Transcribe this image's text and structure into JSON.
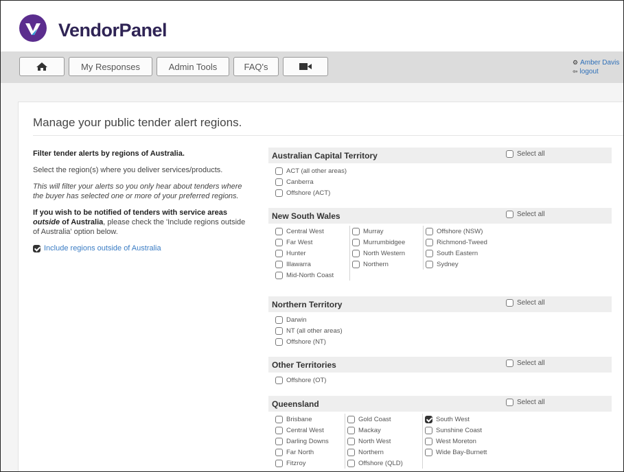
{
  "app": {
    "name": "VendorPanel"
  },
  "nav": {
    "buttons": [
      {
        "label": "",
        "icon": "home-icon"
      },
      {
        "label": "My Responses"
      },
      {
        "label": "Admin Tools"
      },
      {
        "label": "FAQ's"
      },
      {
        "label": "",
        "icon": "video-camera-icon"
      }
    ]
  },
  "user": {
    "name": "Amber Davis",
    "logout": "logout"
  },
  "page": {
    "heading": "Manage your public tender alert regions.",
    "filter_title": "Filter tender alerts by regions of Australia.",
    "select_text": "Select the region(s) where you deliver services/products.",
    "italic_text": "This will filter your alerts so you only hear about tenders where the buyer has selected one or more of your preferred regions.",
    "outside_bold_1": "If you wish to be notified of tenders with service areas ",
    "outside_bold_italic": "outside",
    "outside_bold_2": " of Australia",
    "outside_rest": ", please check the 'Include regions outside of Australia' option below.",
    "include_label": "Include regions outside of Australia",
    "include_checked": true
  },
  "select_all_label": "Select all",
  "regions": [
    {
      "name": "Australian Capital Territory",
      "columns": [
        [
          {
            "label": "ACT (all other areas)",
            "checked": false
          },
          {
            "label": "Canberra",
            "checked": false
          },
          {
            "label": "Offshore (ACT)",
            "checked": false
          }
        ]
      ]
    },
    {
      "name": "New South Wales",
      "columns": [
        [
          {
            "label": "Central West",
            "checked": false
          },
          {
            "label": "Far West",
            "checked": false
          },
          {
            "label": "Hunter",
            "checked": false
          },
          {
            "label": "Illawarra",
            "checked": false
          },
          {
            "label": "Mid-North Coast",
            "checked": false
          }
        ],
        [
          {
            "label": "Murray",
            "checked": false
          },
          {
            "label": "Murrumbidgee",
            "checked": false
          },
          {
            "label": "North Western",
            "checked": false
          },
          {
            "label": "Northern",
            "checked": false
          }
        ],
        [
          {
            "label": "Offshore (NSW)",
            "checked": false
          },
          {
            "label": "Richmond-Tweed",
            "checked": false
          },
          {
            "label": "South Eastern",
            "checked": false
          },
          {
            "label": "Sydney",
            "checked": false
          }
        ]
      ]
    },
    {
      "name": "Northern Territory",
      "columns": [
        [
          {
            "label": "Darwin",
            "checked": false
          },
          {
            "label": "NT (all other areas)",
            "checked": false
          },
          {
            "label": "Offshore (NT)",
            "checked": false
          }
        ]
      ]
    },
    {
      "name": "Other Territories",
      "columns": [
        [
          {
            "label": "Offshore (OT)",
            "checked": false
          }
        ]
      ]
    },
    {
      "name": "Queensland",
      "columns": [
        [
          {
            "label": "Brisbane",
            "checked": false
          },
          {
            "label": "Central West",
            "checked": false
          },
          {
            "label": "Darling Downs",
            "checked": false
          },
          {
            "label": "Far North",
            "checked": false
          },
          {
            "label": "Fitzroy",
            "checked": false
          }
        ],
        [
          {
            "label": "Gold Coast",
            "checked": false
          },
          {
            "label": "Mackay",
            "checked": false
          },
          {
            "label": "North West",
            "checked": false
          },
          {
            "label": "Northern",
            "checked": false
          },
          {
            "label": "Offshore (QLD)",
            "checked": false
          }
        ],
        [
          {
            "label": "South West",
            "checked": true
          },
          {
            "label": "Sunshine Coast",
            "checked": false
          },
          {
            "label": "West Moreton",
            "checked": false
          },
          {
            "label": "Wide Bay-Burnett",
            "checked": false
          }
        ]
      ]
    }
  ]
}
